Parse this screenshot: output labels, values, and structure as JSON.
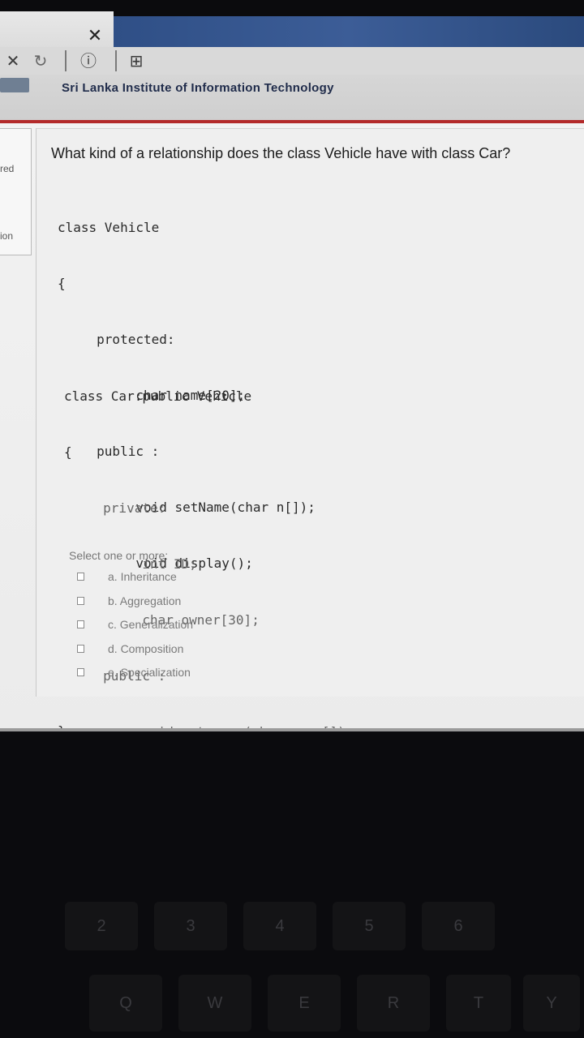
{
  "browser": {
    "close_glyph": "✕",
    "nav_icons": [
      "✕",
      "↻",
      "ⓘ",
      "⊞"
    ]
  },
  "site": {
    "title": "Sri Lanka Institute of Information Technology"
  },
  "left_nav": {
    "items": [
      "red",
      "ion"
    ]
  },
  "question": {
    "text": "What kind of a relationship does the class Vehicle have with class Car?",
    "code_vehicle": [
      "class Vehicle",
      "{",
      "     protected:",
      "          char name[20];",
      "     public :",
      "          void setName(char n[]);",
      "          void display();",
      "",
      "",
      "};"
    ],
    "code_car": [
      "class Car:public Vehicle",
      "{",
      "     private:",
      "          int ID;",
      "          char owner[30];",
      "     public :",
      "          void setowner(char pown[]);",
      "",
      "",
      "};"
    ],
    "select_label": "Select one or more:",
    "options": [
      {
        "label": "a. Inheritance",
        "checked": false
      },
      {
        "label": "b. Aggregation",
        "checked": false
      },
      {
        "label": "c. Generalization",
        "checked": false
      },
      {
        "label": "d. Composition",
        "checked": false
      },
      {
        "label": "e. Specialization",
        "checked": false
      }
    ]
  },
  "keyboard": {
    "row_numbers": [
      "2",
      "3",
      "4",
      "5",
      "6"
    ],
    "row_letters": [
      "Q",
      "W",
      "E",
      "R",
      "T",
      "Y"
    ]
  }
}
